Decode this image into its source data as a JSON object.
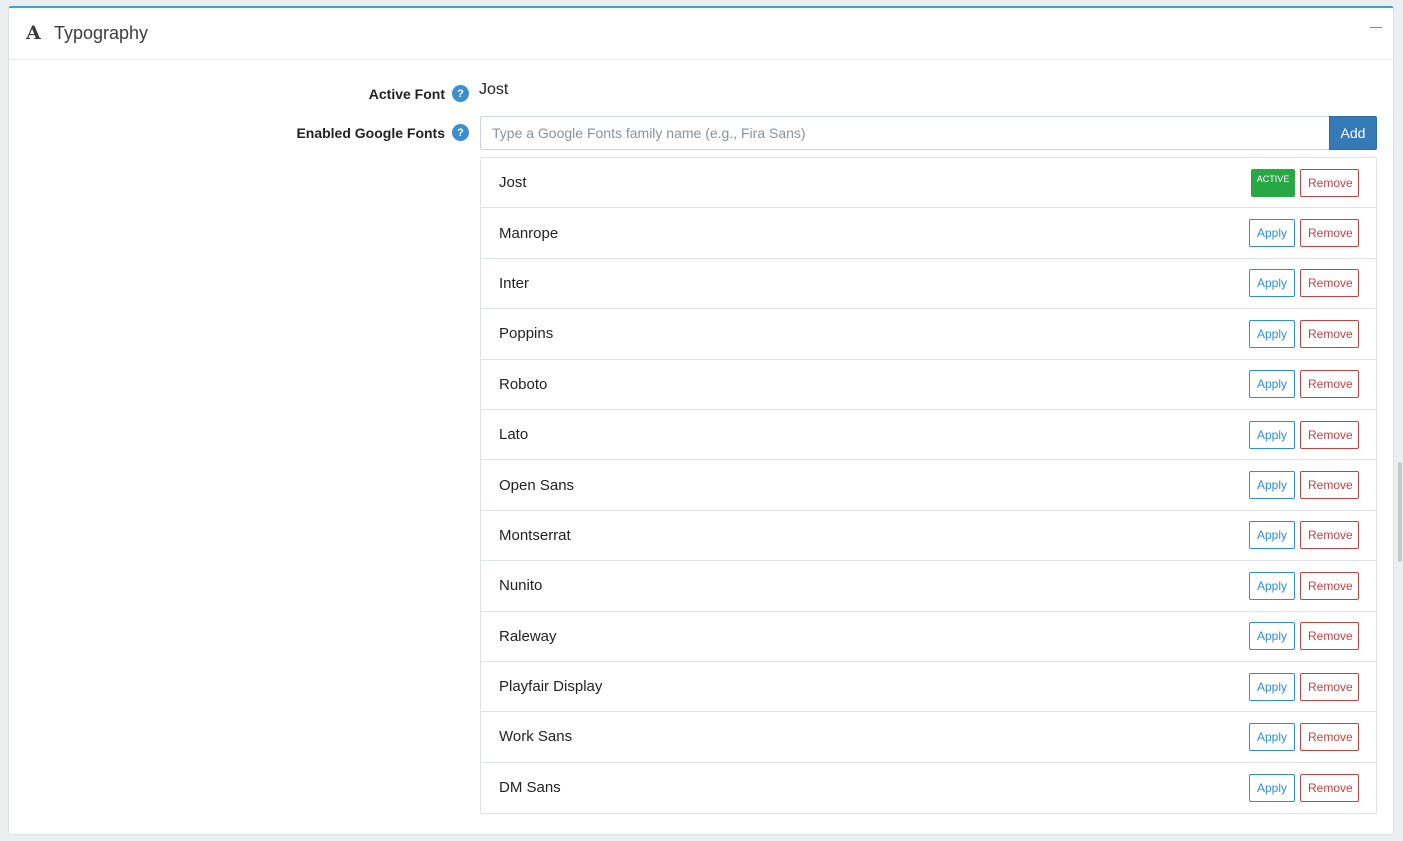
{
  "panel": {
    "title": "Typography",
    "icon": "font-letter-a-icon"
  },
  "active_font": {
    "label": "Active Font",
    "value": "Jost",
    "help": "?"
  },
  "google_fonts": {
    "label": "Enabled Google Fonts",
    "help": "?",
    "placeholder": "Type a Google Fonts family name (e.g., Fira Sans)",
    "add_label": "Add"
  },
  "buttons": {
    "apply": "Apply",
    "remove": "Remove",
    "active_badge": "ACTIVE"
  },
  "fonts": [
    {
      "name": "Jost",
      "active": true
    },
    {
      "name": "Manrope",
      "active": false
    },
    {
      "name": "Inter",
      "active": false
    },
    {
      "name": "Poppins",
      "active": false
    },
    {
      "name": "Roboto",
      "active": false
    },
    {
      "name": "Lato",
      "active": false
    },
    {
      "name": "Open Sans",
      "active": false
    },
    {
      "name": "Montserrat",
      "active": false
    },
    {
      "name": "Nunito",
      "active": false
    },
    {
      "name": "Raleway",
      "active": false
    },
    {
      "name": "Playfair Display",
      "active": false
    },
    {
      "name": "Work Sans",
      "active": false
    },
    {
      "name": "DM Sans",
      "active": false
    }
  ],
  "colors": {
    "accent": "#2ea8e0",
    "primary": "#337ab7",
    "apply": "#2d8fd5",
    "remove": "#c9403f",
    "active_badge": "#28a745"
  }
}
